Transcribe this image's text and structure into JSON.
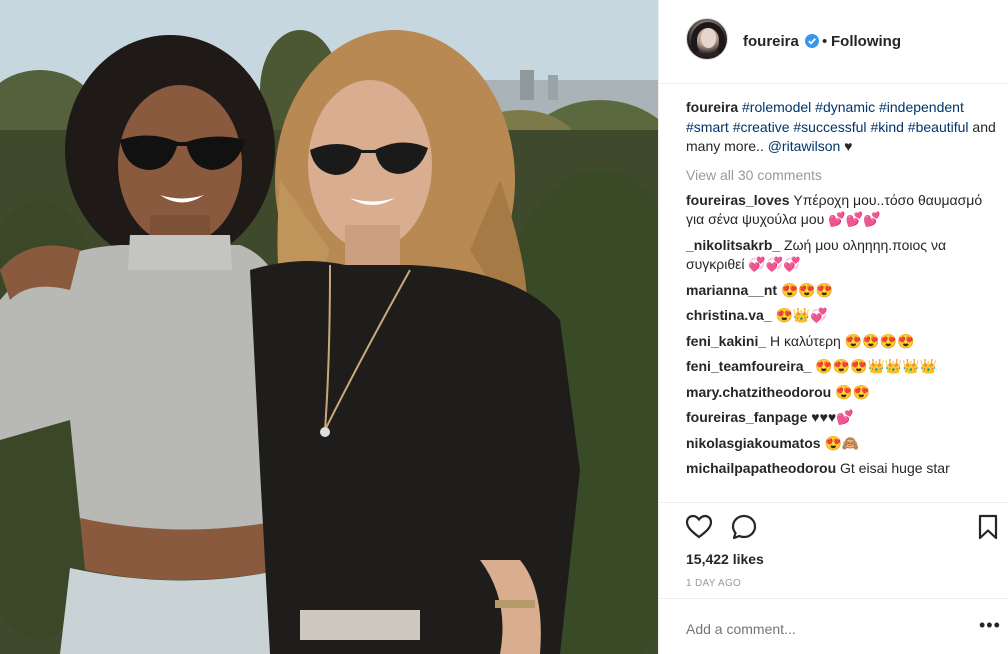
{
  "post": {
    "image_alt": "Two women with sunglasses posing outdoors",
    "colors": {
      "link": "#003569",
      "muted": "#999999",
      "verified": "#3897f0",
      "text": "#262626"
    }
  },
  "header": {
    "username": "foureira",
    "separator": "•",
    "follow_state": "Following",
    "icons": [
      "avatar",
      "verified-badge-icon"
    ]
  },
  "caption": {
    "username": "foureira",
    "hashtags": [
      "#rolemodel",
      "#dynamic",
      "#independent",
      "#smart",
      "#creative",
      "#successful",
      "#kind",
      "#beautiful"
    ],
    "text": "and many more..",
    "mention": "@ritawilson",
    "emoji": "♥"
  },
  "view_all_comments": "View all 30 comments",
  "comments": [
    {
      "user": "foureiras_loves",
      "text": "Υπέροχη μου..τόσο θαυμασμό για σένα ψυχούλα μου 💕💕💕"
    },
    {
      "user": "_nikolitsakrb_",
      "text": "Ζωή μου οληηηη.ποιος να συγκριθεί 💞💞💞"
    },
    {
      "user": "marianna__nt",
      "text": "😍😍😍"
    },
    {
      "user": "christina.va_",
      "text": "😍👑💞"
    },
    {
      "user": "feni_kakini_",
      "text": "Η καλύτερη 😍😍😍😍"
    },
    {
      "user": "feni_teamfoureira_",
      "text": "😍😍😍👑👑👑👑"
    },
    {
      "user": "mary.chatzitheodorou",
      "text": "😍😍"
    },
    {
      "user": "foureiras_fanpage",
      "text": "♥♥♥💕"
    },
    {
      "user": "nikolasgiakoumatos",
      "text": "😍🙈"
    },
    {
      "user": "michailpapatheodorou",
      "text": "Gt eisai huge star"
    }
  ],
  "actions": {
    "icons": [
      "heart-icon",
      "comment-icon",
      "bookmark-icon"
    ],
    "likes": "15,422 likes",
    "time": "1 DAY AGO"
  },
  "add_comment": {
    "placeholder": "Add a comment...",
    "more_label": "•••"
  }
}
